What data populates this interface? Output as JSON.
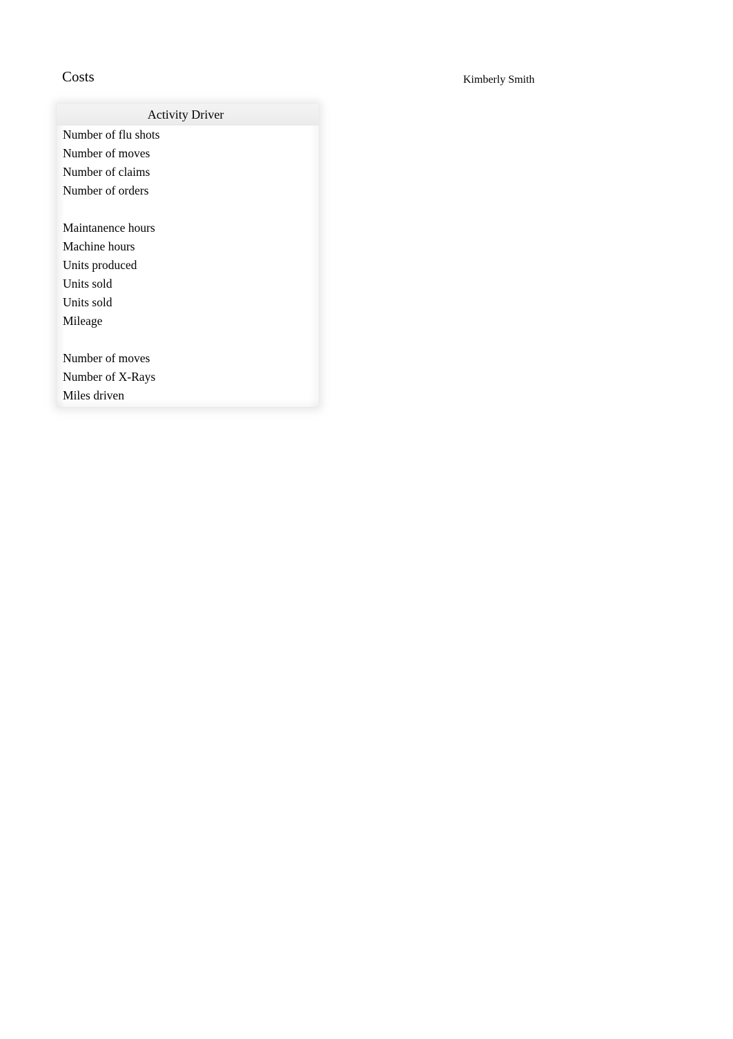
{
  "document": {
    "title": "Costs",
    "author": "Kimberly Smith"
  },
  "table": {
    "header": "Activity Driver",
    "rows": [
      {
        "label": "Number of flu shots",
        "blank": false
      },
      {
        "label": "Number of moves",
        "blank": false
      },
      {
        "label": "Number of claims",
        "blank": false
      },
      {
        "label": "Number of orders",
        "blank": false
      },
      {
        "label": "",
        "blank": true
      },
      {
        "label": "Maintanence hours",
        "blank": false
      },
      {
        "label": "Machine hours",
        "blank": false
      },
      {
        "label": "Units produced",
        "blank": false
      },
      {
        "label": "Units sold",
        "blank": false
      },
      {
        "label": "Units sold",
        "blank": false
      },
      {
        "label": "Mileage",
        "blank": false
      },
      {
        "label": "",
        "blank": true
      },
      {
        "label": "Number of moves",
        "blank": false
      },
      {
        "label": "Number of X-Rays",
        "blank": false
      },
      {
        "label": "Miles driven",
        "blank": false
      }
    ]
  },
  "colors": {
    "page_background": "#ffffff",
    "text": "#000000",
    "header_band": "#efefef",
    "shadow": "#e9e9e9"
  }
}
